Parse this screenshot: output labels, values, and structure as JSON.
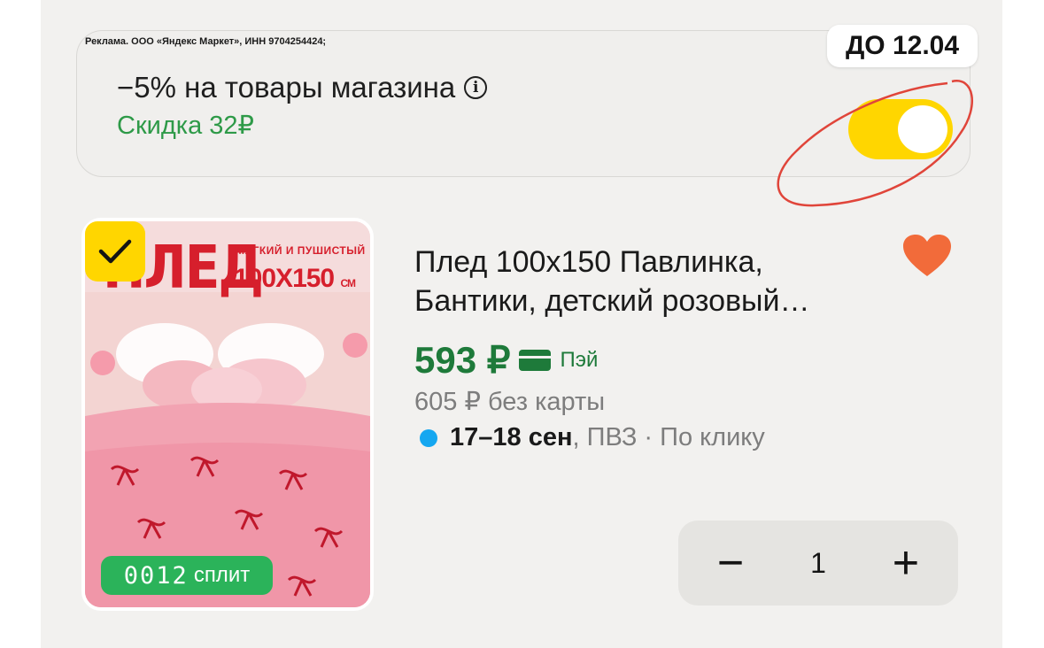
{
  "promo": {
    "ad_note": "Реклама. ООО «Яндекс Маркет», ИНН 9704254424;",
    "title": "−5% на товары магазина",
    "subtitle": "Скидка 32₽",
    "until_badge": "ДО 12.04",
    "toggle_on": true,
    "accent_color": "#ffd600"
  },
  "product": {
    "image": {
      "title_text": "ПЛЕД",
      "subtitle_1": "МЯГКИЙ И ПУШИСТЫЙ",
      "subtitle_2": "100X150",
      "subtitle_unit": "СМ",
      "split_number": "0012",
      "split_label": "сплит",
      "selected": true
    },
    "title_line1": "Плед 100х150 Павлинка,",
    "title_line2": "Бантики, детский розовый…",
    "price": "593 ₽",
    "pay_label": "Пэй",
    "old_price": "605 ₽ без карты",
    "delivery_date": "17–18 сен",
    "delivery_rest": ", ПВЗ · По клику",
    "favorite": true,
    "quantity": "1",
    "minus_label": "−",
    "plus_label": "+"
  }
}
